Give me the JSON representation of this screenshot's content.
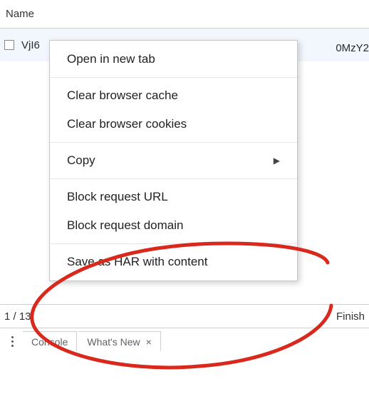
{
  "header": {
    "column_label": "Name"
  },
  "row": {
    "name_fragment_left": "VjI6",
    "name_fragment_right": "0MzY2"
  },
  "context_menu": {
    "open_new_tab": "Open in new tab",
    "clear_cache": "Clear browser cache",
    "clear_cookies": "Clear browser cookies",
    "copy": "Copy",
    "block_url": "Block request URL",
    "block_domain": "Block request domain",
    "save_har": "Save as HAR with content"
  },
  "status": {
    "left_fragment": "1 / 13",
    "right_fragment": "Finish"
  },
  "drawer": {
    "tab_console": "Console",
    "tab_whats_new": "What's New"
  }
}
